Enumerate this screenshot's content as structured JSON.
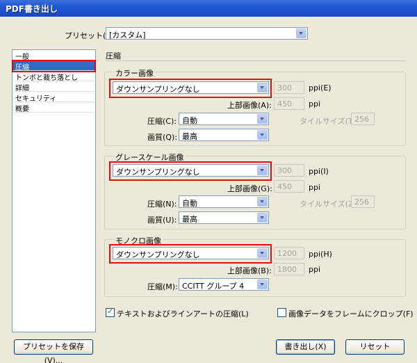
{
  "window": {
    "title": "PDF書き出し"
  },
  "preset": {
    "label": "プリセット(S):",
    "value": "[カスタム]"
  },
  "sidebar": {
    "items": [
      "一般",
      "圧縮",
      "トンボと裁ち落とし",
      "詳細",
      "セキュリティ",
      "概要"
    ],
    "selected": 1
  },
  "panel": {
    "title": "圧縮"
  },
  "color": {
    "group_label": "カラー画像",
    "downsample": "ダウンサンプリングなし",
    "ppi_value": "300",
    "ppi_label": "ppi(E)",
    "upper_label": "上部画像(A):",
    "upper_value": "450",
    "upper_unit": "ppi",
    "compress_label": "圧縮(C):",
    "compress_value": "自動",
    "quality_label": "画質(Q):",
    "quality_value": "最高",
    "tile_label": "タイルサイズ(T):",
    "tile_value": "256"
  },
  "gray": {
    "group_label": "グレースケール画像",
    "downsample": "ダウンサンプリングなし",
    "ppi_value": "300",
    "ppi_label": "ppi(I)",
    "upper_label": "上部画像(G):",
    "upper_value": "450",
    "upper_unit": "ppi",
    "compress_label": "圧縮(N):",
    "compress_value": "自動",
    "quality_label": "画質(U):",
    "quality_value": "最高",
    "tile_label": "タイルサイズ(Z):",
    "tile_value": "256"
  },
  "mono": {
    "group_label": "モノクロ画像",
    "downsample": "ダウンサンプリングなし",
    "ppi_value": "1200",
    "ppi_label": "ppi(H)",
    "upper_label": "上部画像(B):",
    "upper_value": "1800",
    "upper_unit": "ppi",
    "compress_label": "圧縮(M):",
    "compress_value": "CCITT グループ 4"
  },
  "options": {
    "text_art_label": "テキストおよびラインアートの圧縮(L)",
    "text_art_checked": true,
    "crop_label": "画像データをフレームにクロップ(F)",
    "crop_checked": false
  },
  "buttons": {
    "save_preset": "プリセットを保存(V)...",
    "export": "書き出し(X)",
    "reset": "リセット"
  },
  "colors": {
    "accent": "#316ac5",
    "highlight": "#e01010",
    "title_bar": "#1f57d6"
  }
}
